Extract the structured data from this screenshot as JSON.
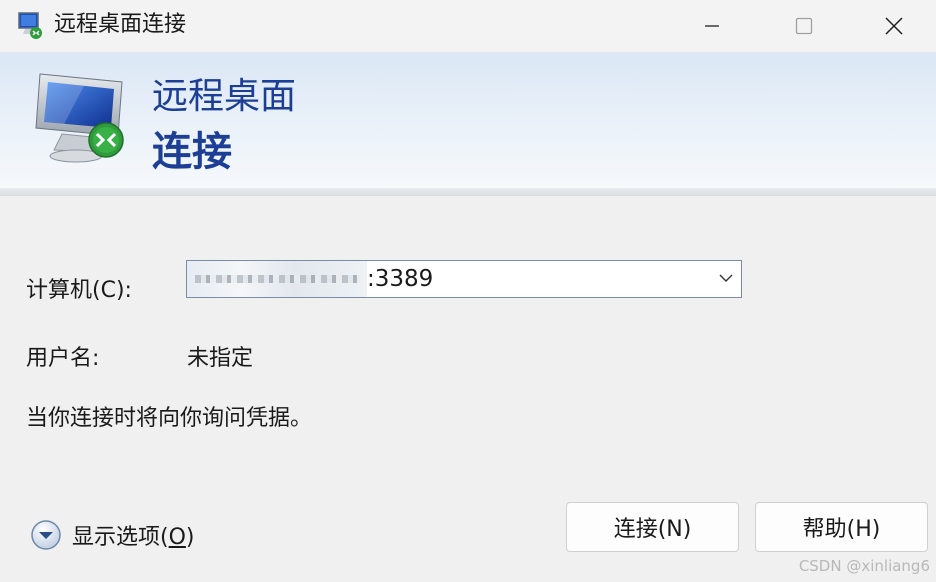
{
  "window": {
    "title": "远程桌面连接"
  },
  "banner": {
    "line1": "远程桌面",
    "line2": "连接"
  },
  "form": {
    "computer_label": "计算机(C):",
    "computer_value_visible": ":3389",
    "username_label": "用户名:",
    "username_value": "未指定",
    "note": "当你连接时将向你询问凭据。"
  },
  "footer": {
    "options_label_prefix": "显示选项(",
    "options_label_key": "O",
    "options_label_suffix": ")",
    "connect_button": "连接(N)",
    "help_button": "帮助(H)"
  },
  "watermark": "CSDN @xinliang6",
  "colors": {
    "banner_text": "#1c3f95",
    "window_bg": "#f0f0f0"
  },
  "icons": [
    "rdp-app-icon",
    "minimize-icon",
    "maximize-icon",
    "close-icon",
    "remote-monitor-icon",
    "dropdown-chevron-icon",
    "expand-options-icon"
  ]
}
